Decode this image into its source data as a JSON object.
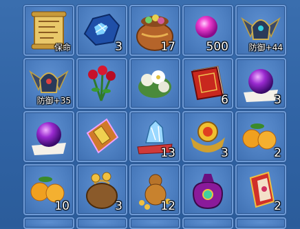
{
  "inventory": {
    "slots": [
      {
        "item": "ancient-scroll",
        "label": "保命",
        "count": ""
      },
      {
        "item": "blue-crystal-ore",
        "label": "",
        "count": "3"
      },
      {
        "item": "treasure-bag",
        "label": "",
        "count": "17"
      },
      {
        "item": "magenta-pearl",
        "label": "",
        "count": "500"
      },
      {
        "item": "winged-helmet",
        "label": "防御+44",
        "count": ""
      },
      {
        "item": "winged-helmet",
        "label": "防御+35",
        "count": ""
      },
      {
        "item": "red-roses",
        "label": "",
        "count": ""
      },
      {
        "item": "white-flowers",
        "label": "",
        "count": ""
      },
      {
        "item": "red-book",
        "label": "",
        "count": "6"
      },
      {
        "item": "purple-orb-on-paper",
        "label": "",
        "count": "3"
      },
      {
        "item": "purple-orb",
        "label": "",
        "count": ""
      },
      {
        "item": "golden-scroll-talisman",
        "label": "",
        "count": ""
      },
      {
        "item": "crystal-on-cushion",
        "label": "",
        "count": "13"
      },
      {
        "item": "golden-emblem",
        "label": "",
        "count": "3"
      },
      {
        "item": "oranges",
        "label": "",
        "count": "2"
      },
      {
        "item": "oranges",
        "label": "",
        "count": "10"
      },
      {
        "item": "coin-bag",
        "label": "",
        "count": "3"
      },
      {
        "item": "gourd-with-coins",
        "label": "",
        "count": "12"
      },
      {
        "item": "purple-pouch",
        "label": "",
        "count": ""
      },
      {
        "item": "red-charm-tag",
        "label": "",
        "count": "2"
      }
    ]
  }
}
